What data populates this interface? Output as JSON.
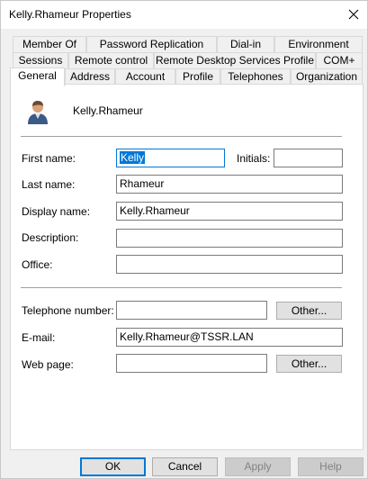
{
  "window": {
    "title": "Kelly.Rhameur Properties"
  },
  "tabs": {
    "row1": [
      "Member Of",
      "Password Replication",
      "Dial-in",
      "Environment"
    ],
    "row2": [
      "Sessions",
      "Remote control",
      "Remote Desktop Services Profile",
      "COM+"
    ],
    "row3": [
      "General",
      "Address",
      "Account",
      "Profile",
      "Telephones",
      "Organization"
    ],
    "active": "General"
  },
  "general": {
    "user_display": "Kelly.Rhameur",
    "first_name_label": "First name:",
    "first_name_value": "Kelly",
    "initials_label": "Initials:",
    "initials_value": "",
    "last_name_label": "Last name:",
    "last_name_value": "Rhameur",
    "display_name_label": "Display name:",
    "display_name_value": "Kelly.Rhameur",
    "description_label": "Description:",
    "description_value": "",
    "office_label": "Office:",
    "office_value": "",
    "telephone_label": "Telephone number:",
    "telephone_value": "",
    "email_label": "E-mail:",
    "email_value": "Kelly.Rhameur@TSSR.LAN",
    "webpage_label": "Web page:",
    "webpage_value": "",
    "other_label": "Other..."
  },
  "buttons": {
    "ok": "OK",
    "cancel": "Cancel",
    "apply": "Apply",
    "help": "Help"
  },
  "icons": {
    "close": "close-icon",
    "user": "user-icon"
  },
  "colors": {
    "accent": "#0078d7",
    "panel": "#ffffff",
    "chrome": "#f0f0f0"
  }
}
